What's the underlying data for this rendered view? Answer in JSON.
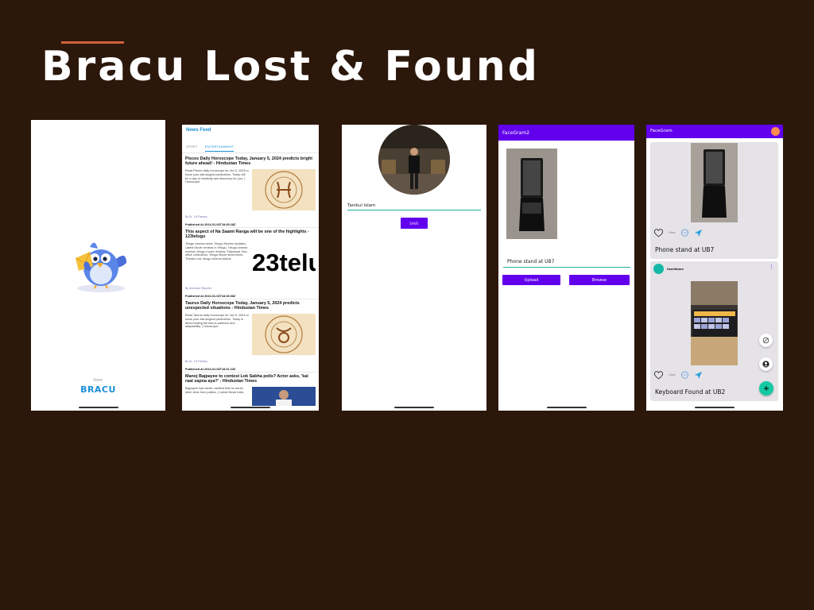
{
  "slide": {
    "title": "Bracu Lost & Found"
  },
  "splash": {
    "from_label": "from",
    "brand_label": "BRACU"
  },
  "news": {
    "title": "News Feed",
    "tabs": [
      "SPORT",
      "ENTERTAINMENT"
    ],
    "articles": [
      {
        "headline": "Pisces Daily Horoscope Today, January 5, 2024 predicts bright future ahead! - Hindustan Times",
        "desc": "Read Pisces daily horoscope for Jan 5, 2024 to know your astrological predictions. Today will be a day of creativity and discovery for you. | Horoscope",
        "author": "By Dr. J N Pandey",
        "published": "Published At 2024-01-04T18:45:18Z"
      },
      {
        "headline": "This aspect of Na Saami Ranga will be one of the highlights - 123telugu",
        "desc": "Telugu cinema news, Telugu Movies Updates, Latest Movie reviews in Telugu, Telugu cinema reviews, telugu movie reviews, Tollywood, Box office collections, Telugu Movie show times, Theater List, telugu cinema tickets",
        "image_text": "23telu",
        "author": "By Unknown Reporter",
        "published": "Published At 2024-01-04T18:36:08Z"
      },
      {
        "headline": "Taurus Daily Horoscope Today, January 5, 2024 predicts unexpected situations - Hindustan Times",
        "desc": "Read Taurus daily horoscope for Jan 5, 2024 to know your astrological predictions. Today is about testing the taurus patience and adaptability. | Horoscope",
        "author": "By Dr. J N Pandey",
        "published": "Published At 2024-01-04T18:31:13Z"
      },
      {
        "headline": "Manoj Bajpayee to contest Lok Sabha polls? Actor asks, 'kal raat sapna aya?' - Hindustan Times",
        "desc": "Bajpayee had earlier clarified that he would steer clear from politics. | Latest News India"
      }
    ]
  },
  "profile": {
    "name": "Tanikul Islam",
    "save_label": "SAVE"
  },
  "upload": {
    "title": "FaceGram2",
    "caption": "Phone stand at UB7",
    "upload_label": "Upload",
    "browse_label": "Browse"
  },
  "feed": {
    "title": "FaceGram",
    "posts": [
      {
        "likes": "Likes",
        "caption": "Phone stand at UB7"
      },
      {
        "username": "UserName",
        "likes": "Likes",
        "caption": "Keyboard Found at UB2"
      }
    ]
  },
  "colors": {
    "background": "#2c170b",
    "accent": "#d2603c",
    "primary": "#6200ee",
    "teal": "#21b0a0",
    "brand": "#1a8fd6"
  }
}
